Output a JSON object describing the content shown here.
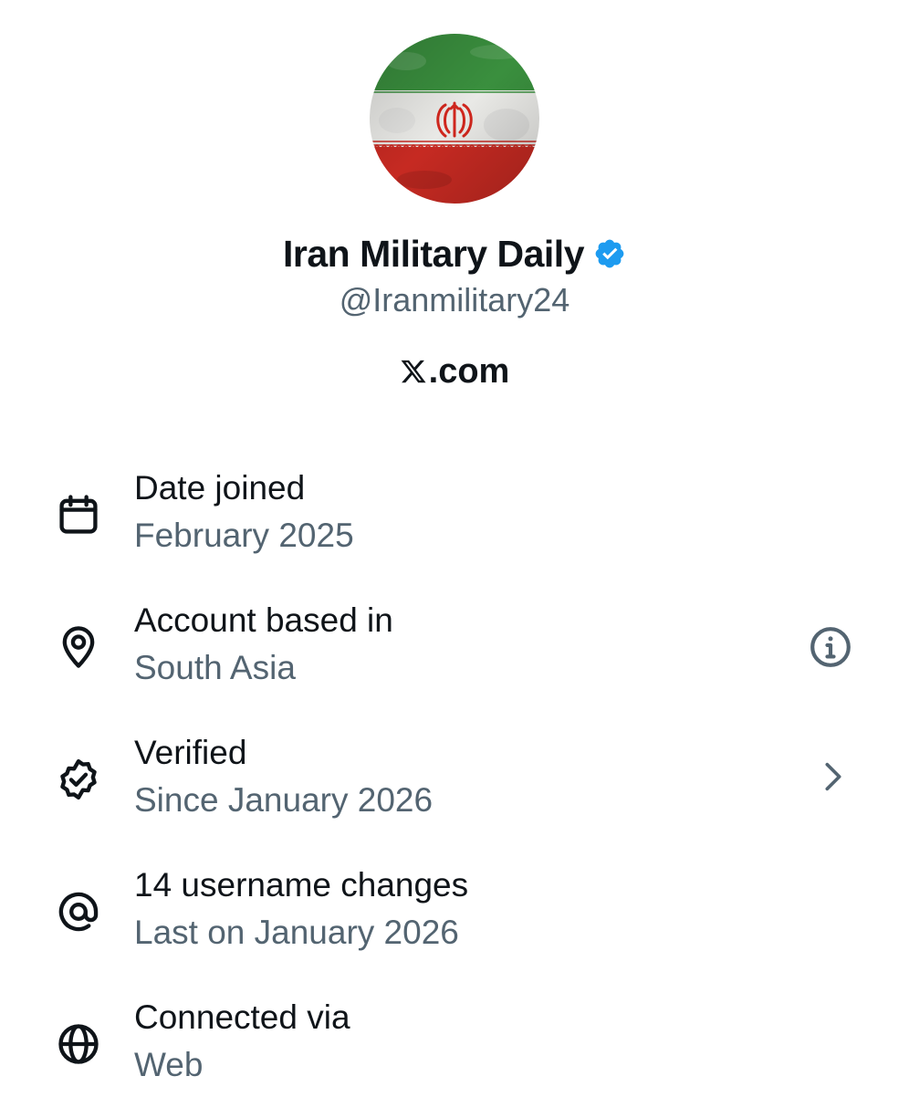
{
  "profile": {
    "display_name": "Iran Military Daily",
    "handle": "@Iranmilitary24",
    "site": "X.com",
    "site_domain": ".com",
    "verified": true,
    "colors": {
      "badge": "#1d9bf0",
      "primary_text": "#0f1419",
      "secondary_text": "#536471"
    },
    "avatar": {
      "description_icon": "iran-flag-avatar",
      "colors": [
        "#239f40",
        "#ffffff",
        "#da0000"
      ]
    }
  },
  "about": {
    "items": [
      {
        "icon": "calendar-icon",
        "title": "Date joined",
        "value": "February 2025"
      },
      {
        "icon": "location-pin-icon",
        "title": "Account based in",
        "value": "South Asia",
        "action_icon": "info-icon"
      },
      {
        "icon": "verified-badge-icon",
        "title": "Verified",
        "value": "Since January 2026",
        "action_icon": "chevron-right-icon"
      },
      {
        "icon": "at-sign-icon",
        "title": "14 username changes",
        "value": "Last on January 2026"
      },
      {
        "icon": "globe-icon",
        "title": "Connected via",
        "value": "Web"
      }
    ]
  }
}
